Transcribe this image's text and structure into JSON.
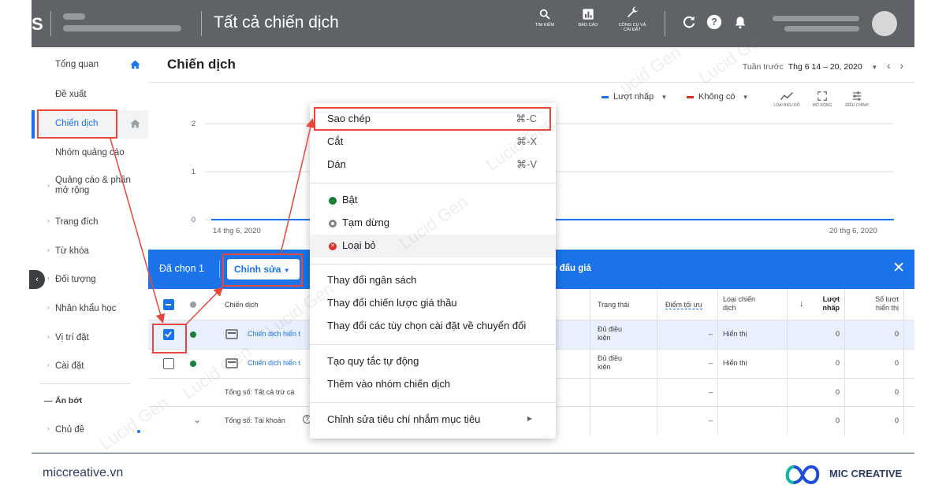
{
  "topbar": {
    "partial_brand": "S",
    "title": "Tất cả chiến dịch",
    "tools": [
      {
        "label": "TÌM KIẾM",
        "icon": "search-icon"
      },
      {
        "label": "BÁO CÁO",
        "icon": "reports-icon"
      },
      {
        "label_line1": "CÔNG CỤ VÀ",
        "label_line2": "CÀI ĐẶT",
        "icon": "wrench-icon"
      }
    ],
    "icons": [
      "refresh-icon",
      "help-icon",
      "notifications-icon"
    ]
  },
  "sidebar": {
    "items": [
      {
        "label": "Tổng quan",
        "icon": "home-icon"
      },
      {
        "label": "Đề xuất"
      },
      {
        "label": "Chiến dịch",
        "icon": "home-icon"
      },
      {
        "label": "Nhóm quảng cáo"
      },
      {
        "label_line1": "Quảng cáo & phần",
        "label_line2": "mở rộng"
      },
      {
        "label": "Trang đích"
      },
      {
        "label": "Từ khóa"
      },
      {
        "label": "Đối tượng"
      },
      {
        "label": "Nhân khẩu học"
      },
      {
        "label": "Vị trí đặt"
      },
      {
        "label": "Cài đặt"
      },
      {
        "label": "Ẩn bớt"
      },
      {
        "label": "Chủ đề"
      }
    ]
  },
  "page": {
    "title": "Chiến dịch",
    "date_prefix": "Tuần trước",
    "date_range": "Thg 6 14 – 20, 2020"
  },
  "chart": {
    "legend": [
      {
        "label": "Lượt nhấp",
        "color": "#1a73e8"
      },
      {
        "label": "Không có",
        "color": "#d93025"
      }
    ],
    "tools": [
      "LOẠI BIỂU ĐỒ",
      "MỞ RỘNG",
      "ĐIỀU CHỈNH"
    ],
    "x_start": "14 thg 6, 2020",
    "x_end": "20 thg 6, 2020"
  },
  "chart_data": {
    "type": "line",
    "x": [
      "14 thg 6, 2020",
      "20 thg 6, 2020"
    ],
    "series": [
      {
        "name": "Lượt nhấp",
        "values": [
          0,
          0
        ]
      }
    ],
    "yticks": [
      0,
      1,
      2
    ],
    "ylim": [
      0,
      2
    ],
    "grid": true,
    "legend_position": "top-right"
  },
  "action_bar": {
    "selected": "Đã chọn 1",
    "edit": "Chỉnh sửa",
    "bid_text": "ề đấu giá"
  },
  "table": {
    "headers": {
      "campaign": "Chiến dịch",
      "status": "Trạng thái",
      "optimization": "Điểm tối ưu",
      "type_line1": "Loại chiến",
      "type_line2": "dịch",
      "clicks_line1": "Lượt",
      "clicks_line2": "nhấp",
      "impr_line1": "Số lượt",
      "impr_line2": "hiển thị"
    },
    "rows": [
      {
        "name": "Chiến dịch hiển t",
        "status_line1": "Đủ điều",
        "status_line2": "kiện",
        "opt": "–",
        "type": "Hiển thị",
        "clicks": "0",
        "impr": "0"
      },
      {
        "name": "Chiến dịch hiển t",
        "status_line1": "Đủ điều",
        "status_line2": "kiện",
        "opt": "–",
        "type": "Hiển thị",
        "clicks": "0",
        "impr": "0"
      }
    ],
    "totals": [
      {
        "label": "Tổng số: Tất cả trừ cá",
        "opt": "–",
        "clicks": "0",
        "impr": "0"
      },
      {
        "label": "Tổng số: Tài khoản",
        "opt": "–",
        "clicks": "0",
        "impr": "0"
      }
    ]
  },
  "menu": {
    "items": [
      {
        "label": "Sao chép",
        "shortcut": "⌘-C"
      },
      {
        "label": "Cắt",
        "shortcut": "⌘-X"
      },
      {
        "label": "Dán",
        "shortcut": "⌘-V"
      },
      {
        "label": "Bật",
        "color": "#188038"
      },
      {
        "label": "Tạm dừng",
        "color": "#80868b"
      },
      {
        "label": "Loại bỏ",
        "color": "#d93025"
      },
      {
        "label": "Thay đổi ngân sách"
      },
      {
        "label": "Thay đổi chiến lược giá thầu"
      },
      {
        "label": "Thay đổi các tùy chọn cài đặt về chuyển đổi"
      },
      {
        "label": "Tạo quy tắc tự động"
      },
      {
        "label": "Thêm vào nhóm chiến dịch"
      },
      {
        "label": "Chỉnh sửa tiêu chí nhắm mục tiêu"
      }
    ]
  },
  "watermark": "Lucid Gen",
  "footer": {
    "site": "miccreative.vn",
    "brand": "MIC CREATIVE",
    "annotation_color": "#e8483b"
  }
}
